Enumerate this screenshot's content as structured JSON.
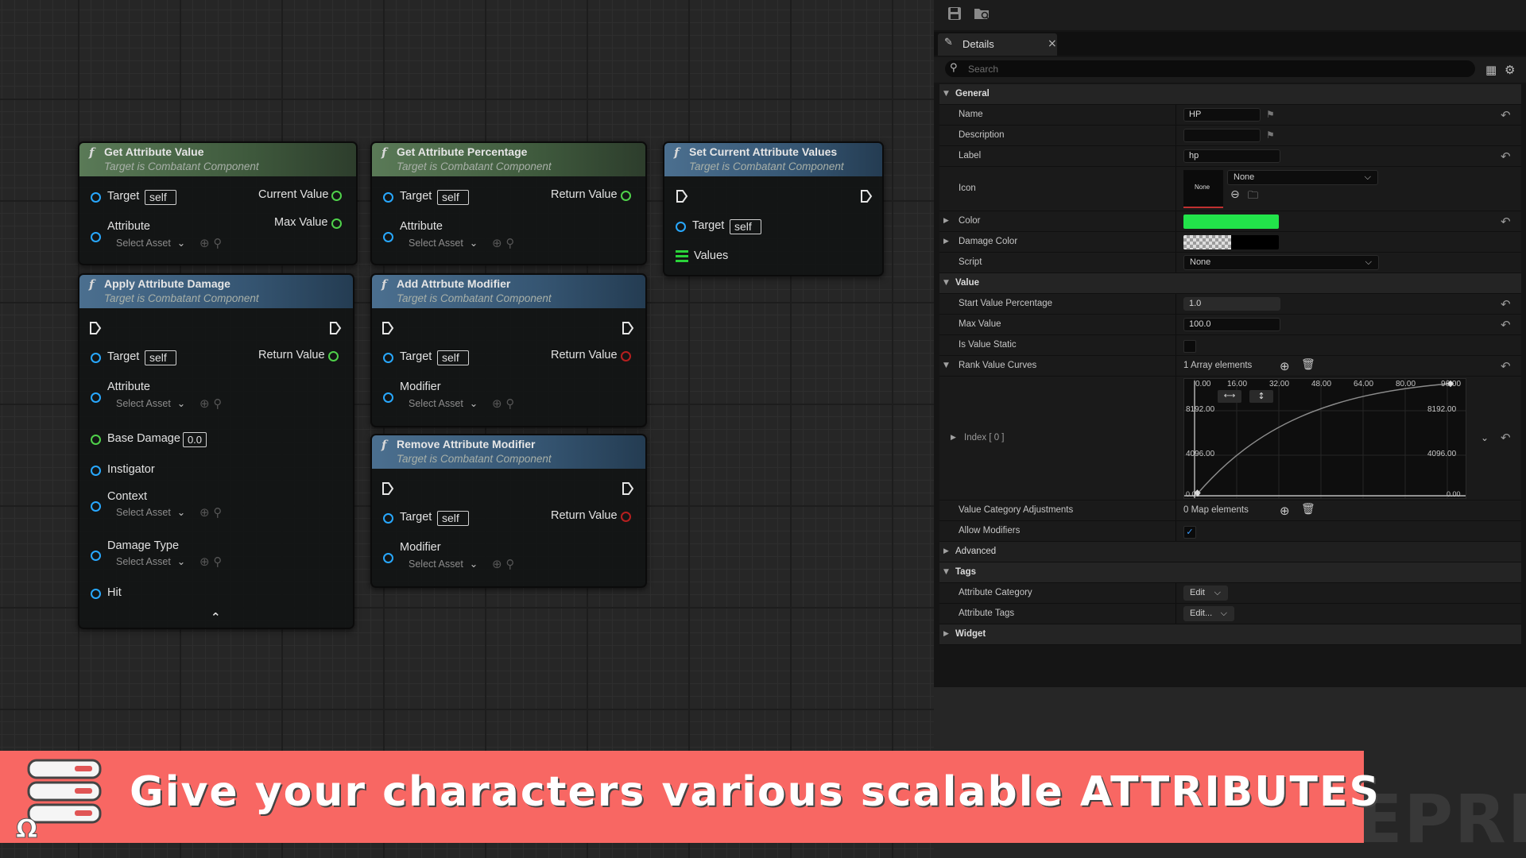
{
  "nodes": {
    "get_attribute_value": {
      "title": "Get Attribute Value",
      "subtitle": "Target is Combatant Component",
      "target_label": "Target",
      "self": "self",
      "attribute_label": "Attribute",
      "select_asset": "Select Asset",
      "out1": "Current Value",
      "out2": "Max Value"
    },
    "get_attribute_percentage": {
      "title": "Get Attribute Percentage",
      "subtitle": "Target is Combatant Component",
      "target_label": "Target",
      "self": "self",
      "attribute_label": "Attribute",
      "select_asset": "Select Asset",
      "out1": "Return Value"
    },
    "set_current_attribute_values": {
      "title": "Set Current Attribute Values",
      "subtitle": "Target is Combatant Component",
      "target_label": "Target",
      "self": "self",
      "values_label": "Values"
    },
    "apply_attribute_damage": {
      "title": "Apply Attribute Damage",
      "subtitle": "Target is Combatant Component",
      "target_label": "Target",
      "self": "self",
      "return_label": "Return Value",
      "attribute_label": "Attribute",
      "select_asset": "Select Asset",
      "base_damage_label": "Base Damage",
      "base_damage_value": "0.0",
      "instigator_label": "Instigator",
      "context_label": "Context",
      "damage_type_label": "Damage Type",
      "hit_label": "Hit"
    },
    "add_attribute_modifier": {
      "title": "Add Attrbute Modifier",
      "subtitle": "Target is Combatant Component",
      "target_label": "Target",
      "self": "self",
      "return_label": "Return Value",
      "modifier_label": "Modifier",
      "select_asset": "Select Asset"
    },
    "remove_attribute_modifier": {
      "title": "Remove Attribute Modifier",
      "subtitle": "Target is Combatant Component",
      "target_label": "Target",
      "self": "self",
      "return_label": "Return Value",
      "modifier_label": "Modifier",
      "select_asset": "Select Asset"
    }
  },
  "details": {
    "tab_label": "Details",
    "search_placeholder": "Search",
    "general": "General",
    "name_label": "Name",
    "name_value": "HP",
    "description_label": "Description",
    "description_value": "",
    "label_label": "Label",
    "label_value": "hp",
    "icon_label": "Icon",
    "icon_preview": "None",
    "icon_value": "None",
    "color_label": "Color",
    "color_value": "#22e34a",
    "damage_color_label": "Damage Color",
    "script_label": "Script",
    "script_value": "None",
    "value": "Value",
    "start_value_label": "Start Value Percentage",
    "start_value": "1.0",
    "max_value_label": "Max Value",
    "max_value": "100.0",
    "is_value_static_label": "Is Value Static",
    "rank_curves_label": "Rank Value Curves",
    "rank_curves_count": "1 Array elements",
    "index_label": "Index [ 0 ]",
    "curve_x_ticks": [
      "0.00",
      "16.00",
      "32.00",
      "48.00",
      "64.00",
      "80.00",
      "96.00"
    ],
    "curve_y_labels": [
      "8192.00",
      "4096.00"
    ],
    "curve_corner_labels": [
      "0.00",
      "0.00"
    ],
    "value_category_label": "Value Category Adjustments",
    "value_category_count": "0 Map elements",
    "allow_modifiers_label": "Allow Modifiers",
    "advanced": "Advanced",
    "tags": "Tags",
    "attr_category_label": "Attribute Category",
    "attr_category_value": "Edit",
    "attr_tags_label": "Attribute Tags",
    "attr_tags_value": "Edit...",
    "widget": "Widget"
  },
  "banner": {
    "text": "Give your characters various scalable ATTRIBUTES",
    "color": "#f86763"
  },
  "watermark": "BLUEPRI"
}
